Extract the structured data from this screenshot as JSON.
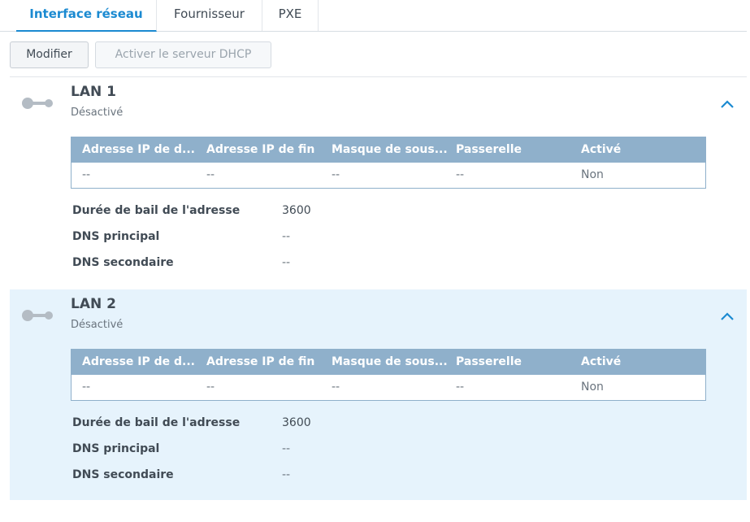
{
  "tabs": [
    {
      "label": "Interface réseau",
      "active": true
    },
    {
      "label": "Fournisseur",
      "active": false
    },
    {
      "label": "PXE",
      "active": false
    }
  ],
  "toolbar": {
    "modify_label": "Modifier",
    "enable_dhcp_label": "Activer le serveur DHCP"
  },
  "colors": {
    "accent": "#1b8ad1",
    "grid_header": "#8fb0cb",
    "selected_row": "#e6f3fc"
  },
  "interfaces": [
    {
      "name": "LAN 1",
      "status": "Désactivé",
      "icon": "network-port-icon",
      "expanded_icon": "chevron-up-icon",
      "columns": [
        "Adresse IP de d...",
        "Adresse IP de fin",
        "Masque de sous...",
        "Passerelle",
        "Activé"
      ],
      "rows": [
        [
          "--",
          "--",
          "--",
          "--",
          "Non"
        ]
      ],
      "properties": [
        {
          "label": "Durée de bail de l'adresse",
          "value": "3600"
        },
        {
          "label": "DNS principal",
          "value": "--"
        },
        {
          "label": "DNS secondaire",
          "value": "--"
        }
      ]
    },
    {
      "name": "LAN 2",
      "status": "Désactivé",
      "icon": "network-port-icon",
      "expanded_icon": "chevron-up-icon",
      "columns": [
        "Adresse IP de d...",
        "Adresse IP de fin",
        "Masque de sous...",
        "Passerelle",
        "Activé"
      ],
      "rows": [
        [
          "--",
          "--",
          "--",
          "--",
          "Non"
        ]
      ],
      "properties": [
        {
          "label": "Durée de bail de l'adresse",
          "value": "3600"
        },
        {
          "label": "DNS principal",
          "value": "--"
        },
        {
          "label": "DNS secondaire",
          "value": "--"
        }
      ]
    }
  ]
}
